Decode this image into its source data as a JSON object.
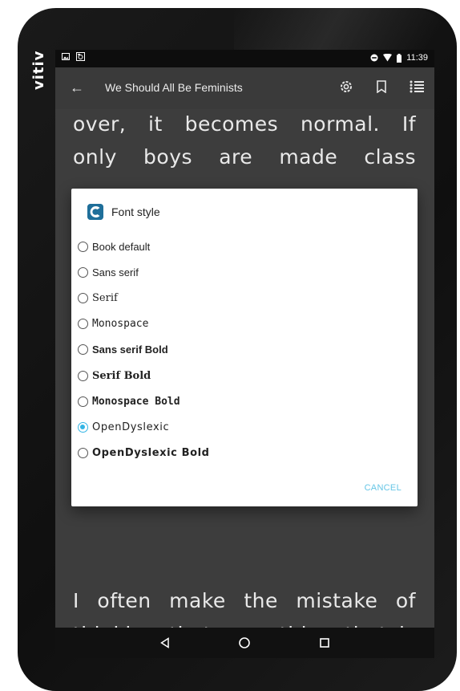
{
  "device": {
    "brand": "vitiv"
  },
  "status_bar": {
    "time": "11:39"
  },
  "app_bar": {
    "title": "We Should All Be Feminists"
  },
  "reading": {
    "lines_top": [
      "over, it becomes normal. If",
      "only boys are made class"
    ],
    "lines_bottom": [
      "I often make the mistake of",
      "thinking that something that is"
    ]
  },
  "dialog": {
    "title": "Font style",
    "options": [
      {
        "label": "Book default",
        "selected": false
      },
      {
        "label": "Sans serif",
        "selected": false
      },
      {
        "label": "Serif",
        "selected": false
      },
      {
        "label": "Monospace",
        "selected": false
      },
      {
        "label": "Sans serif Bold",
        "selected": false
      },
      {
        "label": "Serif Bold",
        "selected": false
      },
      {
        "label": "Monospace Bold",
        "selected": false
      },
      {
        "label": "OpenDyslexic",
        "selected": true
      },
      {
        "label": "OpenDyslexic Bold",
        "selected": false
      }
    ],
    "cancel_label": "CANCEL"
  },
  "colors": {
    "accent": "#33b5e5",
    "dialog_bg": "#ffffff",
    "screen_dim": "#404040"
  },
  "icons": {
    "status_left": [
      "image-icon",
      "photo-icon"
    ],
    "status_right": [
      "do-not-disturb-icon",
      "wifi-icon",
      "battery-icon"
    ],
    "app_bar": [
      "back-arrow-icon",
      "settings-icon",
      "bookmark-icon",
      "toc-list-icon"
    ],
    "nav": [
      "back-triangle-icon",
      "home-circle-icon",
      "recents-square-icon"
    ]
  }
}
